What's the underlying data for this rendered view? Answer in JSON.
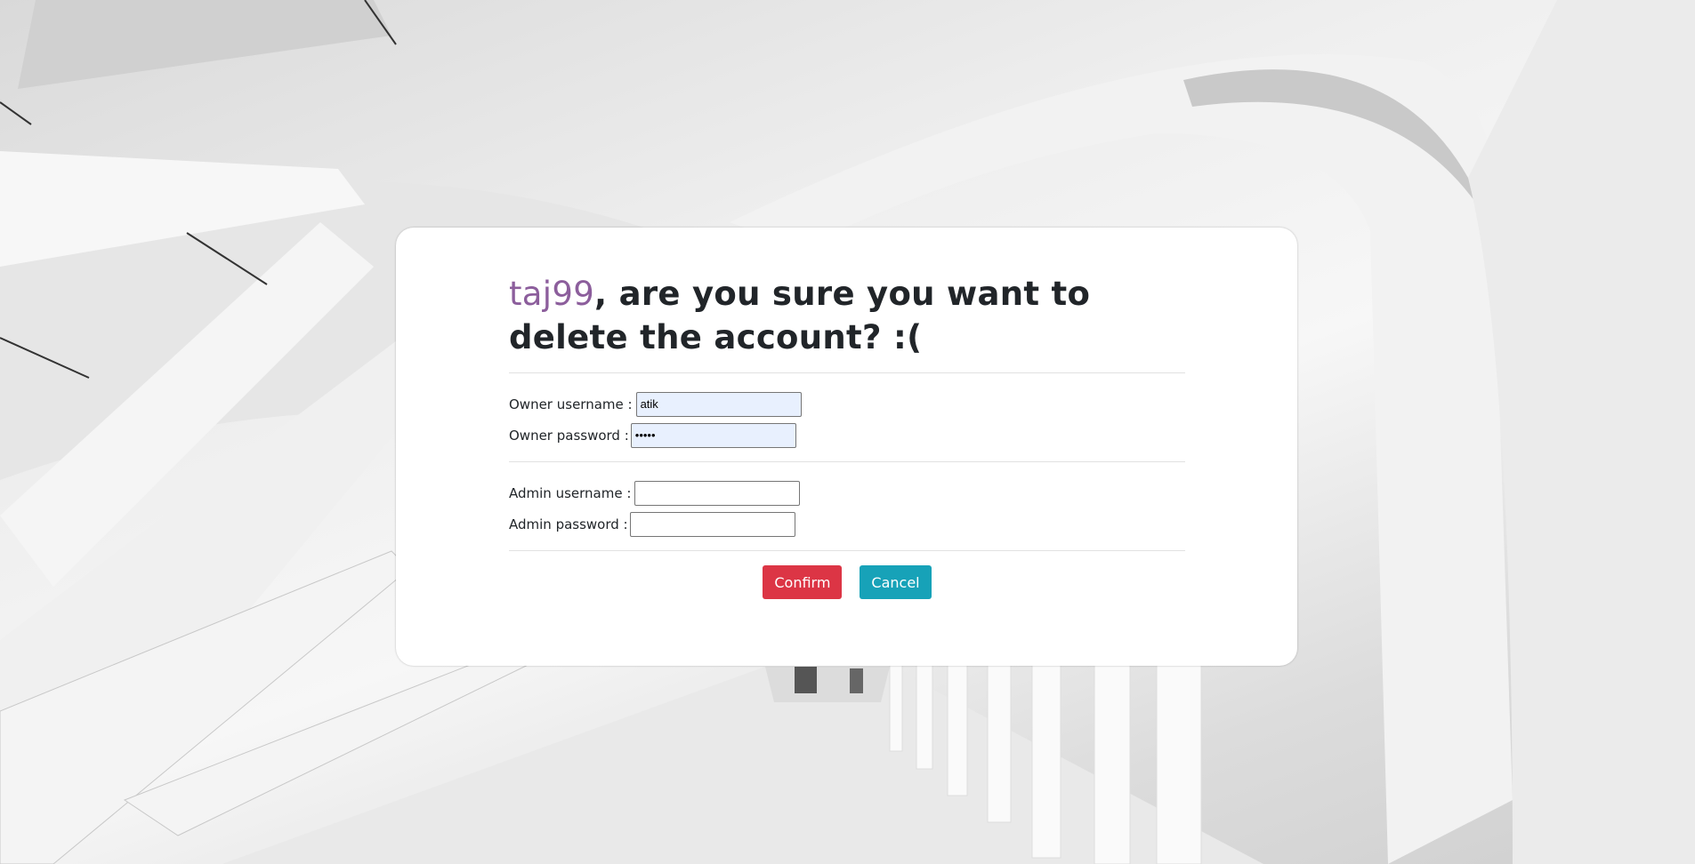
{
  "dialog": {
    "username": "taj99",
    "question": ", are you sure you want to delete the account? :("
  },
  "owner": {
    "username_label": "Owner username :",
    "username_value": "atik",
    "password_label": "Owner password :",
    "password_value": "•••••"
  },
  "admin": {
    "username_label": "Admin username :",
    "username_value": "",
    "password_label": "Admin password :",
    "password_value": ""
  },
  "actions": {
    "confirm_label": "Confirm",
    "cancel_label": "Cancel"
  },
  "colors": {
    "username": "#8c5e9c",
    "confirm": "#dc3545",
    "cancel": "#17a2b8",
    "autofill": "#e8f0fe"
  }
}
